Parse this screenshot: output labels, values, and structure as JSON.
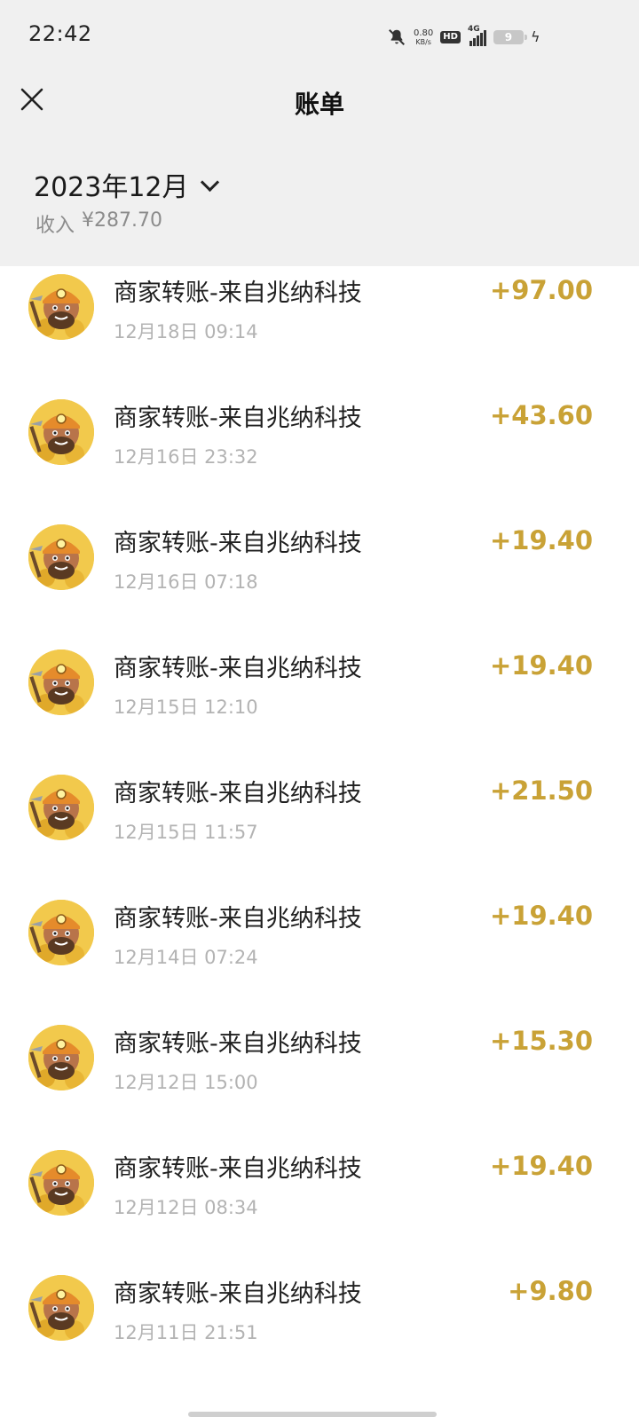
{
  "status_bar": {
    "time": "22:42",
    "net_speed": "0.80",
    "net_speed_unit": "KB/s",
    "hd_label": "HD",
    "network_type": "4G",
    "battery_level": "9"
  },
  "nav": {
    "title": "账单",
    "close_icon": "close-icon"
  },
  "summary": {
    "month": "2023年12月",
    "income_label": "收入",
    "income_amount": "¥287.70"
  },
  "colors": {
    "amount": "#c9a236",
    "header_bg": "#f0f0f0",
    "time_text": "#b3b3b3"
  },
  "transactions": [
    {
      "title": "商家转账-来自兆纳科技",
      "time": "12月18日 09:14",
      "amount": "+97.00"
    },
    {
      "title": "商家转账-来自兆纳科技",
      "time": "12月16日 23:32",
      "amount": "+43.60"
    },
    {
      "title": "商家转账-来自兆纳科技",
      "time": "12月16日 07:18",
      "amount": "+19.40"
    },
    {
      "title": "商家转账-来自兆纳科技",
      "time": "12月15日 12:10",
      "amount": "+19.40"
    },
    {
      "title": "商家转账-来自兆纳科技",
      "time": "12月15日 11:57",
      "amount": "+21.50"
    },
    {
      "title": "商家转账-来自兆纳科技",
      "time": "12月14日 07:24",
      "amount": "+19.40"
    },
    {
      "title": "商家转账-来自兆纳科技",
      "time": "12月12日 15:00",
      "amount": "+15.30"
    },
    {
      "title": "商家转账-来自兆纳科技",
      "time": "12月12日 08:34",
      "amount": "+19.40"
    },
    {
      "title": "商家转账-来自兆纳科技",
      "time": "12月11日 21:51",
      "amount": "+9.80"
    }
  ]
}
